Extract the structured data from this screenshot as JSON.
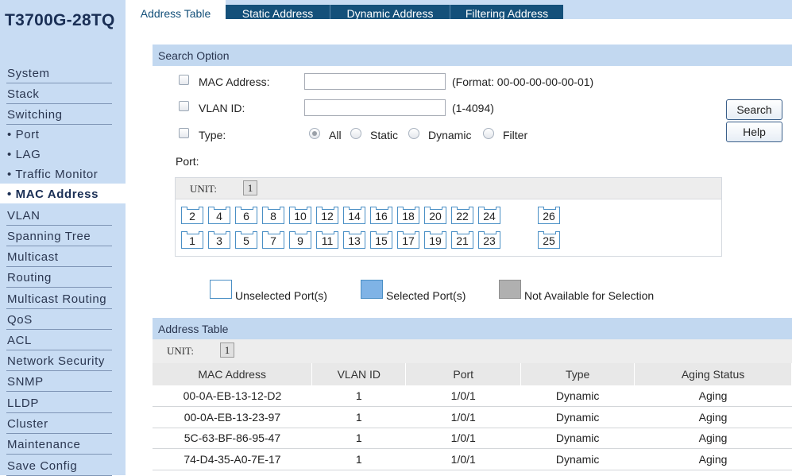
{
  "model": "T3700G-28TQ",
  "nav": [
    {
      "label": "System",
      "kind": "top"
    },
    {
      "label": "Stack",
      "kind": "top"
    },
    {
      "label": "Switching",
      "kind": "top"
    },
    {
      "label": "• Port",
      "kind": "sub"
    },
    {
      "label": "• LAG",
      "kind": "sub"
    },
    {
      "label": "• Traffic Monitor",
      "kind": "sub"
    },
    {
      "label": "• MAC Address",
      "kind": "active"
    },
    {
      "label": "VLAN",
      "kind": "top"
    },
    {
      "label": "Spanning Tree",
      "kind": "top"
    },
    {
      "label": "Multicast",
      "kind": "top"
    },
    {
      "label": "Routing",
      "kind": "top"
    },
    {
      "label": "Multicast Routing",
      "kind": "top"
    },
    {
      "label": "QoS",
      "kind": "top"
    },
    {
      "label": "ACL",
      "kind": "top"
    },
    {
      "label": "Network Security",
      "kind": "top"
    },
    {
      "label": "SNMP",
      "kind": "top"
    },
    {
      "label": "LLDP",
      "kind": "top"
    },
    {
      "label": "Cluster",
      "kind": "top"
    },
    {
      "label": "Maintenance",
      "kind": "top"
    },
    {
      "label": "Save Config",
      "kind": "top"
    }
  ],
  "tabs": [
    "Address Table",
    "Static Address",
    "Dynamic Address",
    "Filtering Address"
  ],
  "search": {
    "header": "Search Option",
    "mac_label": "MAC Address:",
    "mac_value": "",
    "mac_hint": "(Format: 00-00-00-00-00-01)",
    "vlan_label": "VLAN ID:",
    "vlan_value": "",
    "vlan_hint": "(1-4094)",
    "type_label": "Type:",
    "type_options": [
      "All",
      "Static",
      "Dynamic",
      "Filter"
    ],
    "type_selected": "All",
    "port_label": "Port:",
    "unit_label": "UNIT:",
    "unit_value": "1",
    "search_button": "Search",
    "help_button": "Help"
  },
  "ports": {
    "top_row": [
      "2",
      "4",
      "6",
      "8",
      "10",
      "12",
      "14",
      "16",
      "18",
      "20",
      "22",
      "24",
      "26"
    ],
    "bottom_row": [
      "1",
      "3",
      "5",
      "7",
      "9",
      "11",
      "13",
      "15",
      "17",
      "19",
      "21",
      "23",
      "25"
    ]
  },
  "legend": {
    "unselected": "Unselected Port(s)",
    "selected": "Selected Port(s)",
    "unavailable": "Not Available for Selection"
  },
  "colors": {
    "sidebar": "#c8dcf3",
    "tab_inactive": "#14507a",
    "section_bar": "#c2d8f0",
    "port_border": "#4a8fc5",
    "selected_fill": "#7fb3e6",
    "unavailable_fill": "#b0b0b0"
  },
  "table": {
    "header": "Address Table",
    "unit_label": "UNIT:",
    "unit_value": "1",
    "columns": [
      "MAC Address",
      "VLAN ID",
      "Port",
      "Type",
      "Aging Status"
    ],
    "rows": [
      [
        "00-0A-EB-13-12-D2",
        "1",
        "1/0/1",
        "Dynamic",
        "Aging"
      ],
      [
        "00-0A-EB-13-23-97",
        "1",
        "1/0/1",
        "Dynamic",
        "Aging"
      ],
      [
        "5C-63-BF-86-95-47",
        "1",
        "1/0/1",
        "Dynamic",
        "Aging"
      ],
      [
        "74-D4-35-A0-7E-17",
        "1",
        "1/0/1",
        "Dynamic",
        "Aging"
      ]
    ]
  }
}
